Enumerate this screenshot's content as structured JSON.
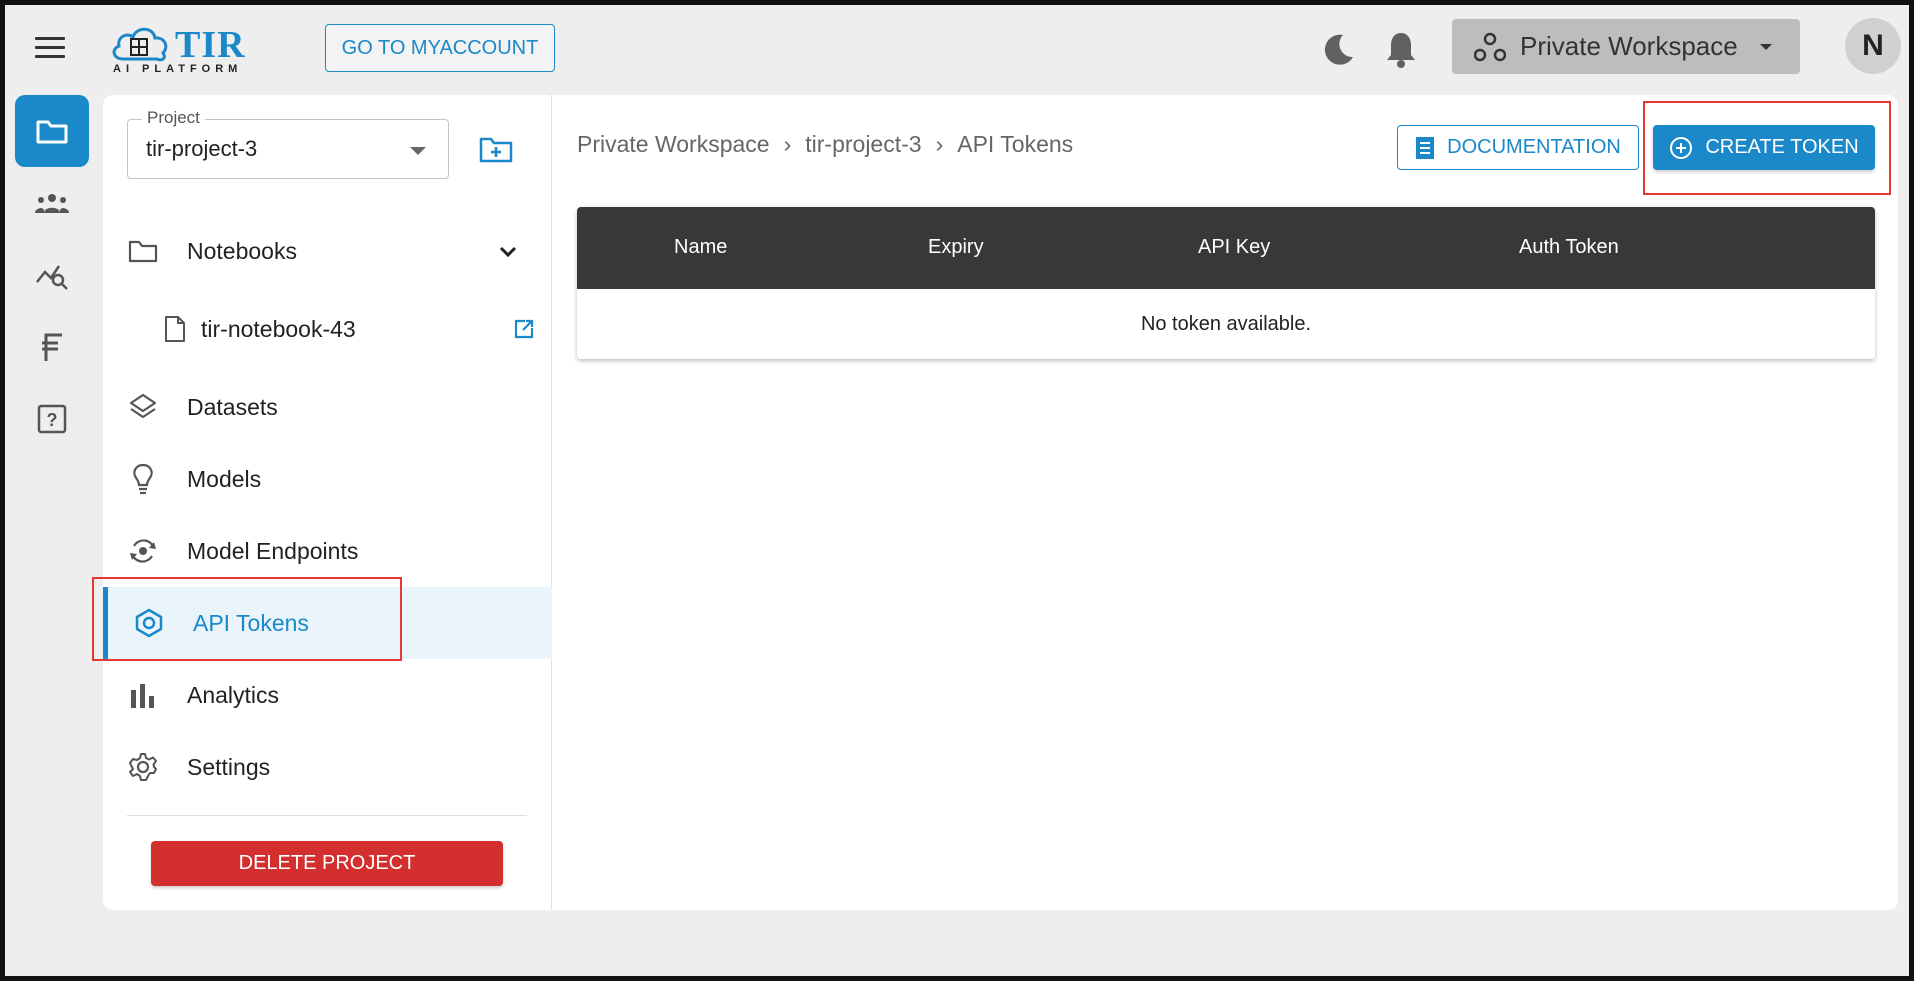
{
  "header": {
    "logo_text": "TIR",
    "logo_subtitle": "AI PLATFORM",
    "myaccount_label": "GO TO MYACCOUNT",
    "workspace_label": "Private Workspace",
    "avatar_initial": "N"
  },
  "rail": {
    "items": [
      {
        "icon": "folder-icon",
        "active": true
      },
      {
        "icon": "team-icon",
        "active": false
      },
      {
        "icon": "analytics-search-icon",
        "active": false
      },
      {
        "icon": "currency-icon",
        "active": false
      },
      {
        "icon": "help-icon",
        "active": false
      }
    ]
  },
  "sidebar": {
    "project_legend": "Project",
    "project_value": "tir-project-3",
    "items": [
      {
        "label": "Notebooks",
        "icon": "folder-outline-icon"
      },
      {
        "label": "tir-notebook-43",
        "icon": "file-icon"
      },
      {
        "label": "Datasets",
        "icon": "layers-icon"
      },
      {
        "label": "Models",
        "icon": "lightbulb-icon"
      },
      {
        "label": "Model Endpoints",
        "icon": "endpoint-icon"
      },
      {
        "label": "API Tokens",
        "icon": "token-icon",
        "active": true
      },
      {
        "label": "Analytics",
        "icon": "bar-chart-icon"
      },
      {
        "label": "Settings",
        "icon": "gear-icon"
      }
    ],
    "delete_label": "DELETE PROJECT"
  },
  "content": {
    "breadcrumb": [
      "Private Workspace",
      "tir-project-3",
      "API Tokens"
    ],
    "breadcrumb_sep": "›",
    "documentation_label": "DOCUMENTATION",
    "create_label": "CREATE TOKEN",
    "table": {
      "columns": [
        "Name",
        "Expiry",
        "API Key",
        "Auth Token"
      ],
      "empty_text": "No token available."
    }
  },
  "colors": {
    "accent": "#1a88c9",
    "danger": "#d32f2f",
    "table_header": "#383838",
    "highlight": "#e53935"
  }
}
